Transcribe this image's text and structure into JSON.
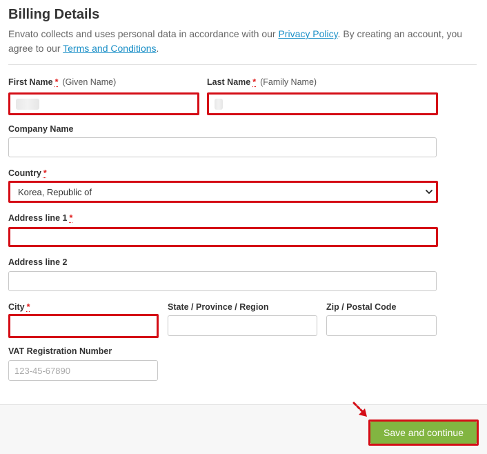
{
  "header": {
    "title": "Billing Details",
    "intro_prefix": "Envato collects and uses personal data in accordance with our ",
    "privacy_link": "Privacy Policy",
    "intro_middle": ". By creating an account, you agree to our ",
    "terms_link": "Terms and Conditions",
    "intro_suffix": "."
  },
  "form": {
    "required_marker": "*",
    "first_name": {
      "label": "First Name",
      "hint": "(Given Name)",
      "value": ""
    },
    "last_name": {
      "label": "Last Name",
      "hint": "(Family Name)",
      "value": ""
    },
    "company": {
      "label": "Company Name",
      "value": ""
    },
    "country": {
      "label": "Country",
      "value": "Korea, Republic of"
    },
    "address1": {
      "label": "Address line 1",
      "value": ""
    },
    "address2": {
      "label": "Address line 2",
      "value": ""
    },
    "city": {
      "label": "City",
      "value": ""
    },
    "state": {
      "label": "State / Province / Region",
      "value": ""
    },
    "zip": {
      "label": "Zip / Postal Code",
      "value": ""
    },
    "vat": {
      "label": "VAT Registration Number",
      "placeholder": "123-45-67890",
      "value": ""
    }
  },
  "footer": {
    "save_label": "Save and continue"
  },
  "colors": {
    "error_border": "#d40d16",
    "link": "#1a8fc7",
    "save_button": "#82b541",
    "required": "#e02020"
  },
  "icons": {
    "select": "chevron-down-icon",
    "pointer": "arrow-pointer-icon"
  }
}
